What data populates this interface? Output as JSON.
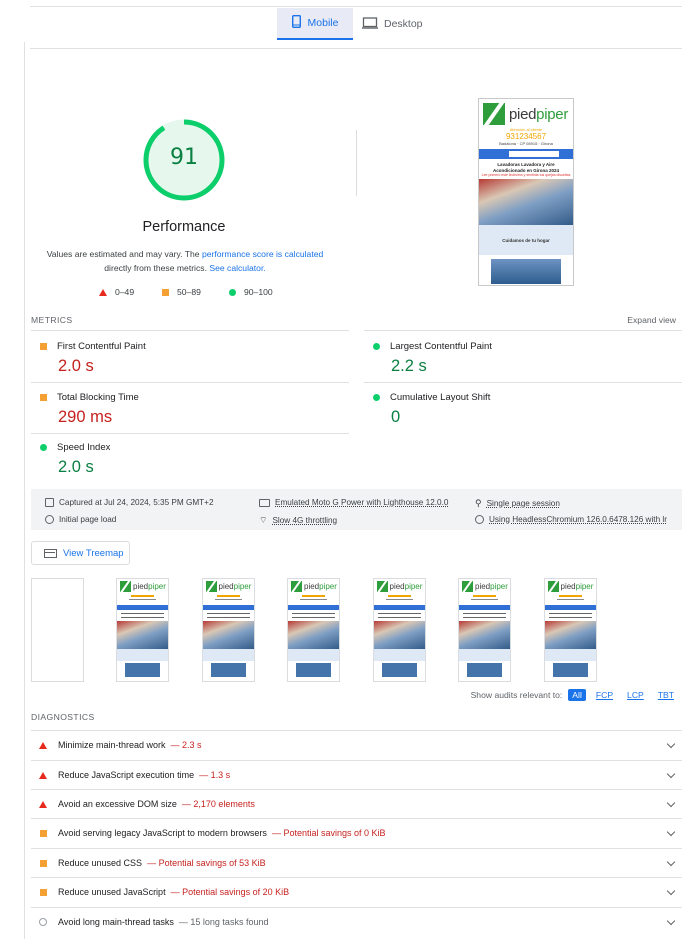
{
  "tabs": {
    "mobile_label": "Mobile",
    "desktop_label": "Desktop",
    "active": "Mobile"
  },
  "score": {
    "value": "91",
    "fraction": 0.91,
    "title": "Performance",
    "desc_prefix": "Values are estimated and may vary. The ",
    "desc_link": "performance score is calculated",
    "desc_middle": "directly from these metrics. ",
    "desc_link2": "See calculator.",
    "legend": {
      "low": "0–49",
      "mid": "50–89",
      "high": "90–100"
    }
  },
  "screenshot": {
    "brand_a": "pied",
    "brand_b": "piper",
    "attention": "Atención al cliente",
    "phone": "931234567",
    "address": "Badalona · CP 08915 · Girona",
    "heading": "Lavadoras Lavadora y Aire Acondicionado en Girona 2024",
    "red_line": "Lee primero este lindísimo y sentirás tus quejas disueltas",
    "box_title": "Cuidamos de tu hogar"
  },
  "metrics": {
    "section_label": "METRICS",
    "expand_label": "Expand view",
    "items": [
      {
        "name": "First Contentful Paint",
        "value": "2.0 s",
        "rating": "average"
      },
      {
        "name": "Largest Contentful Paint",
        "value": "2.2 s",
        "rating": "good"
      },
      {
        "name": "Total Blocking Time",
        "value": "290 ms",
        "rating": "average"
      },
      {
        "name": "Cumulative Layout Shift",
        "value": "0",
        "rating": "good"
      },
      {
        "name": "Speed Index",
        "value": "2.0 s",
        "rating": "good"
      }
    ]
  },
  "info": {
    "captured": "Captured at Jul 24, 2024, 5:35 PM GMT+2",
    "initial_load": "Initial page load",
    "device": "Emulated Moto G Power with Lighthouse 12.0.0",
    "throttling": "Slow 4G throttling",
    "session": "Single page session",
    "browser": "Using HeadlessChromium 126.0.6478.126 with lr"
  },
  "treemap": {
    "label": "View Treemap"
  },
  "filmstrip": {
    "frames": 7
  },
  "audits_filter": {
    "label": "Show audits relevant to:",
    "options": [
      "All",
      "FCP",
      "LCP",
      "TBT"
    ],
    "active": "All"
  },
  "diagnostics": {
    "section_label": "DIAGNOSTICS",
    "items": [
      {
        "title": "Minimize main-thread work",
        "detail": "— 2.3 s",
        "severity": "fail"
      },
      {
        "title": "Reduce JavaScript execution time",
        "detail": "— 1.3 s",
        "severity": "fail"
      },
      {
        "title": "Avoid an excessive DOM size",
        "detail": "— 2,170 elements",
        "severity": "fail"
      },
      {
        "title": "Avoid serving legacy JavaScript to modern browsers",
        "detail": "— Potential savings of 0 KiB",
        "severity": "average"
      },
      {
        "title": "Reduce unused CSS",
        "detail": "— Potential savings of 53 KiB",
        "severity": "average"
      },
      {
        "title": "Reduce unused JavaScript",
        "detail": "— Potential savings of 20 KiB",
        "severity": "average"
      },
      {
        "title": "Avoid long main-thread tasks",
        "detail": "— 15 long tasks found",
        "severity": "info"
      }
    ]
  },
  "colors": {
    "accent": "#1a73e8",
    "pass": "#0cce6b",
    "average": "#f4a032",
    "fail": "#e8291d"
  }
}
